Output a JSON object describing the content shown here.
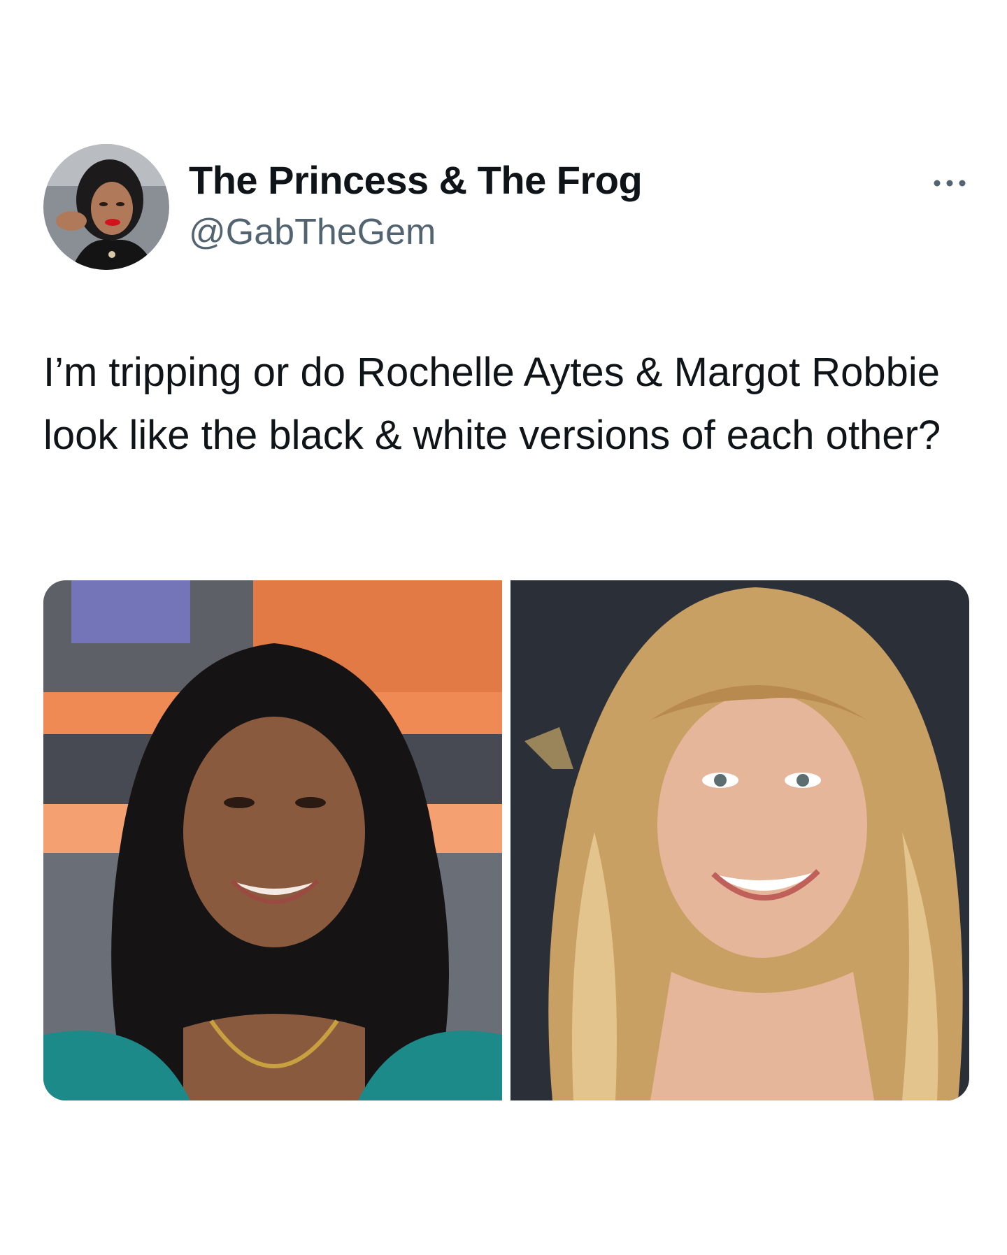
{
  "author": {
    "display_name": "The Princess & The Frog",
    "handle": "@GabTheGem",
    "avatar_icon": "profile-photo"
  },
  "tweet": {
    "text": "I’m tripping or do Rochelle Aytes & Margot Robbie look like the black & white versions of each other?"
  },
  "menu": {
    "icon": "more-horizontal-icon"
  },
  "media": {
    "photos": [
      {
        "subject": "left-photo"
      },
      {
        "subject": "right-photo"
      }
    ]
  },
  "colors": {
    "text_primary": "#0f1419",
    "text_secondary": "#536471",
    "background": "#ffffff"
  }
}
